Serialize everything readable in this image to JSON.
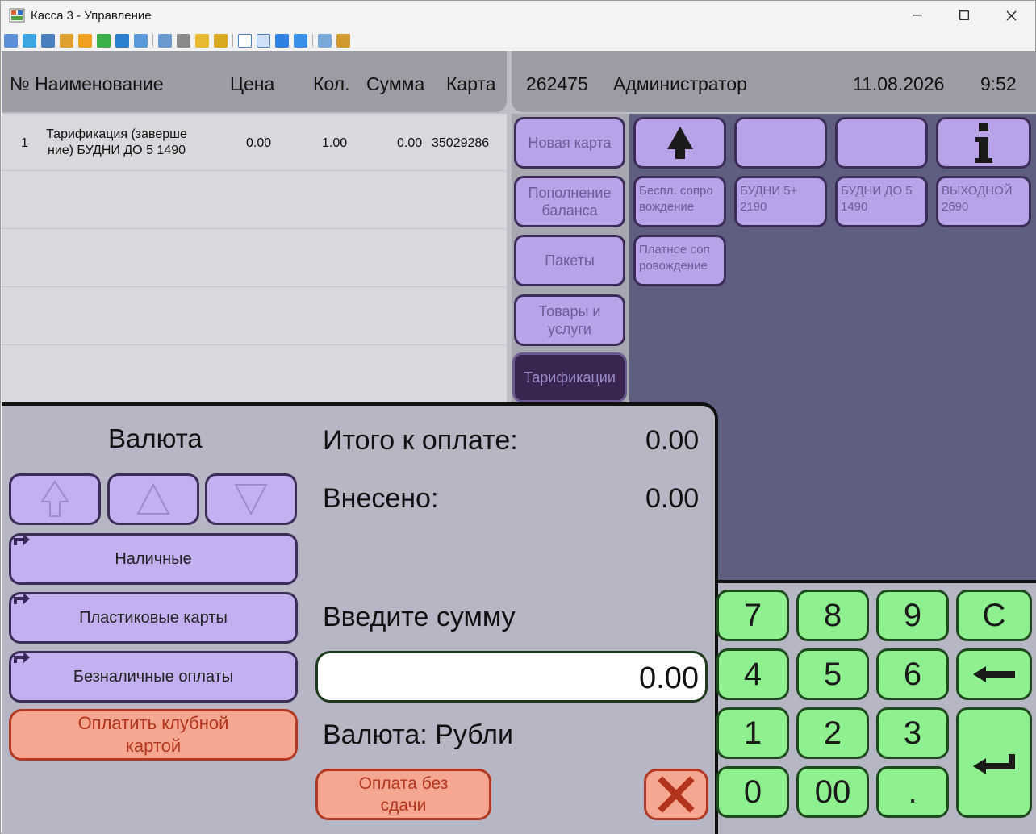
{
  "window": {
    "title": "Касса 3 - Управление"
  },
  "toolbar": {
    "icons": [
      "screen-icon",
      "monitor-icon",
      "console-icon",
      "sync-icon",
      "clock-icon",
      "chat-icon",
      "phone-icon",
      "message-icon",
      "upload-icon",
      "network-icon",
      "lock-icon",
      "lock2-icon",
      "window-icon",
      "fullscreen-icon",
      "blue-screen-icon",
      "target-icon",
      "copy-icon",
      "tools-icon"
    ]
  },
  "header": {
    "col_num_name": "№ Наименование",
    "col_price": "Цена",
    "col_qty": "Кол.",
    "col_sum": "Сумма",
    "col_card": "Карта",
    "card_id": "262475",
    "user": "Администратор",
    "date": "11.08.2026",
    "time": "9:52"
  },
  "order_rows": [
    {
      "num": "1",
      "name": "Тарификация (заверше ние) БУДНИ ДО 5 1490",
      "price": "0.00",
      "qty": "1.00",
      "sum": "0.00",
      "card": "35029286"
    }
  ],
  "categories": [
    {
      "label": "Новая карта"
    },
    {
      "label": "Пополнение баланса"
    },
    {
      "label": "Пакеты"
    },
    {
      "label": "Товары и услуги"
    },
    {
      "label": "Тарификации"
    }
  ],
  "tiles": {
    "row1_up_icon": "arrow-up-icon",
    "row1_info_icon": "info-icon",
    "row2": [
      {
        "label": "Беспл. сопро вождение"
      },
      {
        "label": "БУДНИ 5+ 2190"
      },
      {
        "label": "БУДНИ ДО 5 1490"
      },
      {
        "label": "ВЫХОДНОЙ 2690"
      }
    ],
    "row3": [
      {
        "label": "Платное соп ровождение"
      }
    ]
  },
  "payment": {
    "currency_title": "Валюта",
    "total_label": "Итого к оплате:",
    "total_value": "0.00",
    "paid_label": "Внесено:",
    "paid_value": "0.00",
    "enter_label": "Введите сумму",
    "amount_value": "0.00",
    "currency_label": "Валюта: Рубли",
    "methods": [
      {
        "label": "Наличные"
      },
      {
        "label": "Пластиковые карты"
      },
      {
        "label": "Безналичные оплаты"
      }
    ],
    "club_card_button": "Оплатить клубной картой",
    "no_change_button": "Оплата без сдачи"
  },
  "keypad": [
    "7",
    "8",
    "9",
    "C",
    "4",
    "5",
    "6",
    "1",
    "2",
    "3",
    "0",
    "00",
    "."
  ]
}
